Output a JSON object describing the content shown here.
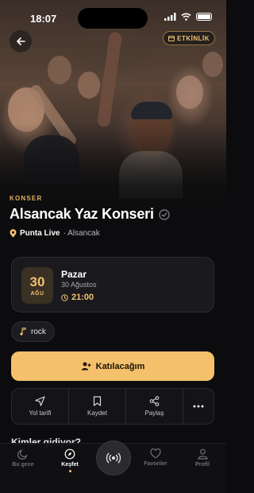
{
  "status_bar": {
    "time": "18:07"
  },
  "header": {
    "tag_label": "ETKİNLİK"
  },
  "event": {
    "category": "KONSER",
    "title": "Alsancak Yaz Konseri",
    "venue": "Punta Live",
    "area": "· Alsancak",
    "day": "30",
    "month": "AĞU",
    "weekday": "Pazar",
    "date_long": "30 Ağustos",
    "time": "21:00",
    "genre": "rock"
  },
  "cta": {
    "label": "Katılacağım"
  },
  "actions": [
    {
      "label": "Yol tarifi",
      "icon": "navigation-icon"
    },
    {
      "label": "Kaydet",
      "icon": "bookmark-icon"
    },
    {
      "label": "Paylaş",
      "icon": "share-icon"
    },
    {
      "label": "",
      "icon": "more-icon"
    }
  ],
  "section": {
    "title": "Kimler gidiyor?"
  },
  "nav": {
    "items": [
      {
        "label": "Bu gece",
        "icon": "moon-icon"
      },
      {
        "label": "Keşfet",
        "icon": "compass-icon",
        "active": true
      },
      {
        "label": "",
        "icon": "live-broadcast-icon"
      },
      {
        "label": "Favoriler",
        "icon": "heart-icon"
      },
      {
        "label": "Profil",
        "icon": "user-icon"
      }
    ]
  },
  "colors": {
    "accent": "#f4c06c",
    "background": "#0c0c0e",
    "card": "#1a1a1e"
  }
}
